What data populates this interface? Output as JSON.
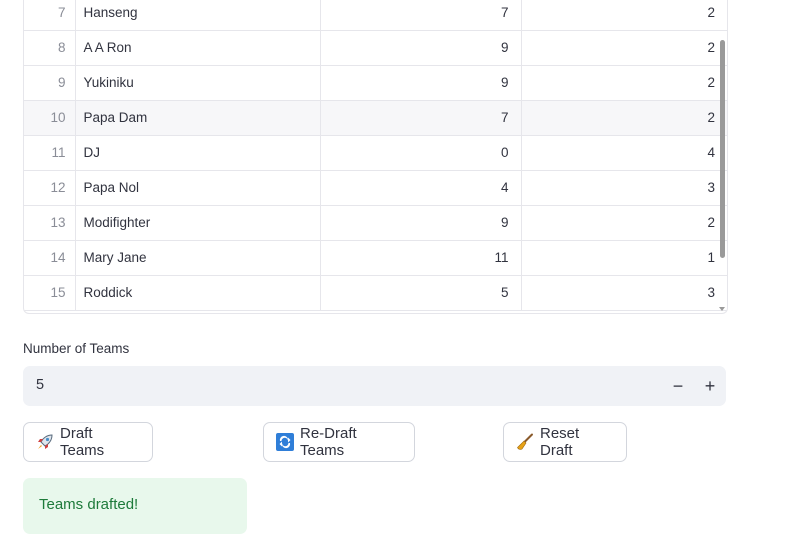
{
  "table": {
    "rows": [
      {
        "index": "7",
        "name": "Hanseng",
        "col_a": "7",
        "col_b": "2"
      },
      {
        "index": "8",
        "name": "A A Ron",
        "col_a": "9",
        "col_b": "2"
      },
      {
        "index": "9",
        "name": "Yukiniku",
        "col_a": "9",
        "col_b": "2"
      },
      {
        "index": "10",
        "name": "Papa Dam",
        "col_a": "7",
        "col_b": "2"
      },
      {
        "index": "11",
        "name": "DJ",
        "col_a": "0",
        "col_b": "4"
      },
      {
        "index": "12",
        "name": "Papa Nol",
        "col_a": "4",
        "col_b": "3"
      },
      {
        "index": "13",
        "name": "Modifighter",
        "col_a": "9",
        "col_b": "2"
      },
      {
        "index": "14",
        "name": "Mary Jane",
        "col_a": "11",
        "col_b": "1"
      },
      {
        "index": "15",
        "name": "Roddick",
        "col_a": "5",
        "col_b": "3"
      }
    ]
  },
  "teams_input": {
    "label": "Number of Teams",
    "value": "5",
    "minus": "−",
    "plus": "+"
  },
  "buttons": {
    "draft": {
      "icon": "rocket-icon",
      "label": "Draft Teams"
    },
    "redraft": {
      "icon": "repeat-icon",
      "label": "Re-Draft Teams"
    },
    "reset": {
      "icon": "broom-icon",
      "label": "Reset Draft"
    }
  },
  "alert": {
    "text": "Teams drafted!"
  },
  "colors": {
    "success_bg": "#e8f8ec",
    "success_text": "#1d7a3a",
    "input_bg": "#f0f2f6"
  }
}
